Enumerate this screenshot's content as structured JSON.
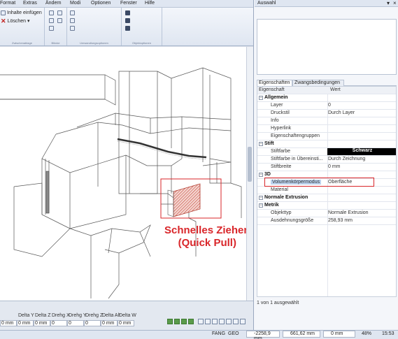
{
  "menu": [
    "Format",
    "Extras",
    "Ändern",
    "Modi",
    "Optionen",
    "Fenster",
    "Hilfe"
  ],
  "ribbon": {
    "clipboard": {
      "paste_label": "Inhalte einfügen",
      "delete_label": "Löschen",
      "group_label": "Zwischenablage"
    },
    "blocks": {
      "group_label": "Blöcke"
    },
    "transform": {
      "group_label": "Umwandlungsoptionen"
    },
    "objects": {
      "group_label": "Objektoptionen"
    }
  },
  "panel": {
    "title": "Auswahl",
    "tabs": [
      "Eigenschaften",
      "Zwangsbedingungen"
    ],
    "header": {
      "name": "Eigenschaft",
      "value": "Wert"
    },
    "status": "1 von 1 ausgewählt"
  },
  "properties": [
    {
      "kind": "cat",
      "name": "Allgemein"
    },
    {
      "kind": "prop",
      "name": "Layer",
      "value": "0"
    },
    {
      "kind": "prop",
      "name": "Druckstil",
      "value": "Durch Layer"
    },
    {
      "kind": "prop",
      "name": "Info",
      "value": ""
    },
    {
      "kind": "prop",
      "name": "Hyperlink",
      "value": ""
    },
    {
      "kind": "prop",
      "name": "Eigenschaftengruppen",
      "value": ""
    },
    {
      "kind": "cat",
      "name": "Stift"
    },
    {
      "kind": "prop",
      "name": "Stiftfarbe",
      "value": "Schwarz"
    },
    {
      "kind": "prop",
      "name": "Stiftfarbe in Übereinsti...",
      "value": "Durch Zeichnung"
    },
    {
      "kind": "prop",
      "name": "Stiftbreite",
      "value": "0 mm"
    },
    {
      "kind": "cat",
      "name": "3D"
    },
    {
      "kind": "prop",
      "name": "Volumenkörpermodus",
      "value": "Oberfläche"
    },
    {
      "kind": "prop",
      "name": "Material",
      "value": ""
    },
    {
      "kind": "cat",
      "name": "Normale Extrusion"
    },
    {
      "kind": "cat",
      "name": "Metrik"
    },
    {
      "kind": "prop",
      "name": "Objekttyp",
      "value": "Normale Extrusion"
    },
    {
      "kind": "prop",
      "name": "Ausdehnungsgröße",
      "value": "258,93 mm"
    }
  ],
  "coords": {
    "headers": [
      "",
      "Delta Y",
      "Delta Z",
      "Drehg X",
      "Drehg Y",
      "Drehg Z",
      "Delta Alt",
      "Delta W"
    ],
    "values": [
      "0 mm",
      "0 mm",
      "0 mm",
      "0",
      "0",
      "0",
      "0 mm",
      "0 mm"
    ]
  },
  "statusbar": {
    "snap": "FANG",
    "geo": "GEO",
    "x": "-2258,9 mm",
    "y": "661,62 mm",
    "z": "0 mm",
    "zoom": "48%",
    "time": "15:53"
  },
  "annotation": {
    "line1": "Schnelles Ziehen",
    "line2": "(Quick Pull)"
  },
  "colors": {
    "accent_red": "#d9262a",
    "stiftfarbe_bg": "#000000",
    "highlight": "#bcd3ef"
  }
}
